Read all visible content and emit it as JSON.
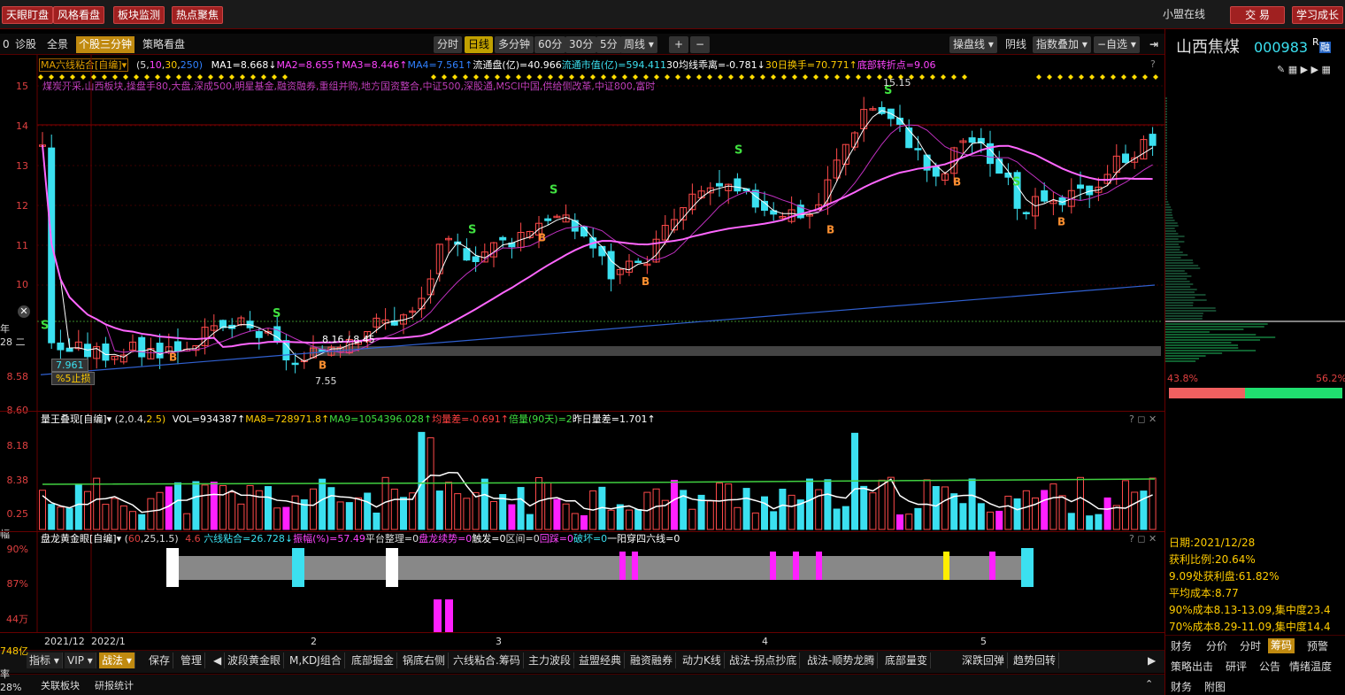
{
  "top": {
    "buttons": [
      "天眼盯盘",
      "风格看盘",
      "板块监测",
      "热点聚焦"
    ],
    "status": "小盟在线",
    "trade": "交 易",
    "learn": "学习成长"
  },
  "nav": {
    "left": [
      "诊股",
      "全景",
      "个股三分钟",
      "策略看盘"
    ],
    "periods": [
      "分时",
      "日线",
      "多分钟",
      "60分",
      "30分",
      "5分",
      "周线 ▾"
    ],
    "zoom": [
      "+",
      "−"
    ],
    "right": [
      "操盘线 ▾",
      "阴线",
      "指数叠加 ▾",
      "−自选 ▾"
    ]
  },
  "stock": {
    "name": "山西焦煤",
    "code": "000983",
    "r": "R",
    "rong": "融"
  },
  "indicator_main": {
    "name": "MA六线粘合[自编]▾",
    "params_open": "(5,",
    "p1": "10",
    "p2": "30",
    "p3": "250)",
    "ma1": "MA1=8.668↓",
    "ma2": "MA2=8.655↑",
    "ma3": "MA3=8.446↑",
    "ma4": "MA4=7.561↑",
    "ltp": "流通盘(亿)=40.966",
    "ltsz": "流通市值(亿)=594.411",
    "dev": "30均线乖离=-0.781↓",
    "turn": "30日换手=70.771↑",
    "bottom": "底部转折点=9.06"
  },
  "concepts": "煤炭开采,山西板块,操盘手80,大盘,深成500,明星基金,融资融券,重组并购,地方国资整合,中证500,深股通,MSCI中国,供给侧改革,中证800,富时",
  "yaxis_main": [
    "15",
    "14",
    "13",
    "12",
    "11",
    "10",
    "8.58",
    "8.60"
  ],
  "left_labels": {
    "year": "年",
    "n28": "28 二",
    "price": "7.961",
    "stop": "%5止损",
    "low": "7.55",
    "mid": "8.16 / 8.45",
    "high": "15.15"
  },
  "volume": {
    "name": "量王叠现[自编]▾",
    "params_open": "(2,0.4,",
    "p3": "2.5)",
    "vol": "VOL=934387↑",
    "ma8": "MA8=728971.8↑",
    "ma9": "MA9=1054396.028↑",
    "jlc": "均量差=-0.691↑",
    "bl": "倍量(90天)=2",
    "zr": "昨日量差=1.701↑",
    "yaxis": [
      "8.18",
      "8.38",
      "0.25"
    ],
    "left_cut": "幅"
  },
  "eye": {
    "name": "盘龙黄金眼[自编]▾",
    "params_open": "(",
    "p1": "60",
    "params_close": ",25,1.5)",
    "p4": "4.6",
    "lx": "六线粘合=26.728↓",
    "zf": "振幅(%)=57.49",
    "pt": "平台整理=0",
    "pl": "盘龙续势=0",
    "cf": "触发=0",
    "qj": "区间=0",
    "hc": "回踩=0",
    "ph": "破坏=0",
    "yy": "一阳穿四六线=0",
    "yaxis": [
      "90%",
      "87%",
      "44万"
    ]
  },
  "xaxis": [
    "2021/12",
    "2022/1",
    "2",
    "3",
    "4",
    "5"
  ],
  "bottom_tabs": {
    "t1": "指标 ▾",
    "t2": "VIP ▾",
    "t3": "战法 ▾",
    "save": "保存",
    "manage": "管理",
    "strategies": [
      "波段黄金眼",
      "M,KDJ组合",
      "底部掘金",
      "锅底右侧",
      "六线粘合.筹码",
      "主力波段",
      "益盟经典",
      "融资融券",
      "动力K线",
      "战法-拐点抄底",
      "战法-顺势龙腾",
      "底部量变",
      "深跌回弹",
      "趋势回转"
    ]
  },
  "footer": {
    "a": "关联板块",
    "b": "研报统计",
    "left1": "748亿",
    "left2": "率",
    "left3": "28%"
  },
  "chips": {
    "left_pct": "43.8%",
    "right_pct": "56.2%",
    "date": "日期:2021/12/28",
    "profit": "获利比例:20.64%",
    "at": "9.09处获利盘:61.82%",
    "avg": "平均成本:8.77",
    "c90": "90%成本8.13-13.09,集中度23.4",
    "c70": "70%成本8.29-11.09,集中度14.4"
  },
  "right_tabs": [
    "财务",
    "分价",
    "分时",
    "筹码",
    "预警"
  ],
  "right_tabs2": [
    "策略出击",
    "研评",
    "公告",
    "情绪温度"
  ],
  "right_tabs3": [
    "财务",
    "附图"
  ],
  "chart_data": {
    "type": "candlestick",
    "title": "",
    "x": [
      "2021/12",
      "2022/1",
      "2",
      "3",
      "4",
      "5"
    ],
    "ylim": [
      7.55,
      15.15
    ],
    "annotations": [
      "15.15",
      "7.55",
      "8.16",
      "8.45",
      "7.961",
      "%5止损"
    ]
  },
  "colors": {
    "up": "#ff4a4a",
    "down": "#3be0f0",
    "accent": "#c08a10"
  }
}
